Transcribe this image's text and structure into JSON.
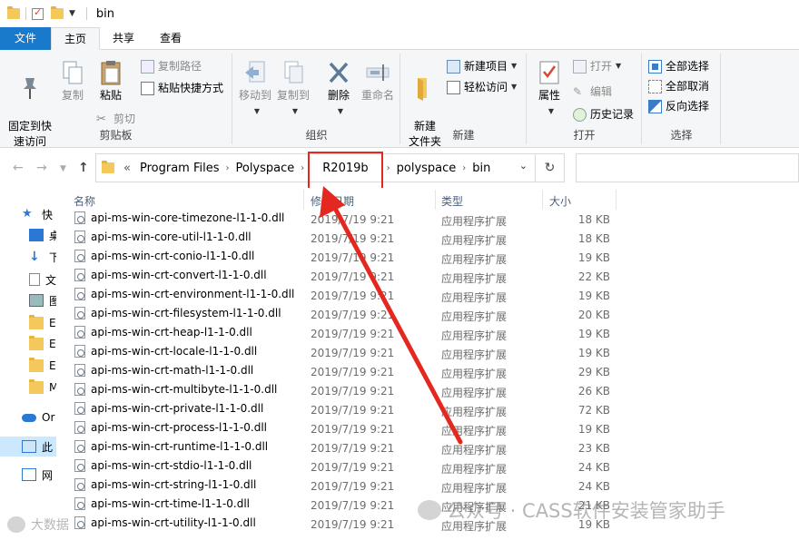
{
  "window": {
    "title": "bin"
  },
  "tabs": [
    "文件",
    "主页",
    "共享",
    "查看"
  ],
  "ribbon": {
    "clipboard": {
      "label": "剪贴板",
      "pin": "固定到快\n速访问",
      "copy": "复制",
      "paste": "粘贴",
      "copy_path": "复制路径",
      "paste_shortcut": "粘贴快捷方式",
      "cut": "剪切"
    },
    "organize": {
      "label": "组织",
      "move_to": "移动到",
      "copy_to": "复制到",
      "delete": "删除",
      "rename": "重命名"
    },
    "new": {
      "label": "新建",
      "new_folder": "新建\n文件夹",
      "new_item": "新建项目",
      "easy_access": "轻松访问"
    },
    "open": {
      "label": "打开",
      "properties": "属性",
      "open": "打开",
      "edit": "编辑",
      "history": "历史记录"
    },
    "select": {
      "label": "选择",
      "select_all": "全部选择",
      "select_none": "全部取消",
      "invert": "反向选择"
    }
  },
  "address": {
    "prefix": "«",
    "crumbs": [
      "Program Files",
      "Polyspace",
      "R2019b",
      "polyspace",
      "bin"
    ],
    "highlighted": "R2019b"
  },
  "nav": {
    "items": [
      "快",
      "桌",
      "下",
      "文",
      "图",
      "E",
      "E",
      "E",
      "M",
      "Or",
      "此",
      "网"
    ]
  },
  "columns": {
    "name": "名称",
    "date": "修改日期",
    "type": "类型",
    "size": "大小"
  },
  "files": [
    {
      "name": "api-ms-win-core-timezone-l1-1-0.dll",
      "date": "2019/7/19 9:21",
      "type": "应用程序扩展",
      "size": "18 KB"
    },
    {
      "name": "api-ms-win-core-util-l1-1-0.dll",
      "date": "2019/7/19 9:21",
      "type": "应用程序扩展",
      "size": "18 KB"
    },
    {
      "name": "api-ms-win-crt-conio-l1-1-0.dll",
      "date": "2019/7/19 9:21",
      "type": "应用程序扩展",
      "size": "19 KB"
    },
    {
      "name": "api-ms-win-crt-convert-l1-1-0.dll",
      "date": "2019/7/19 9:21",
      "type": "应用程序扩展",
      "size": "22 KB"
    },
    {
      "name": "api-ms-win-crt-environment-l1-1-0.dll",
      "date": "2019/7/19 9:21",
      "type": "应用程序扩展",
      "size": "19 KB"
    },
    {
      "name": "api-ms-win-crt-filesystem-l1-1-0.dll",
      "date": "2019/7/19 9:21",
      "type": "应用程序扩展",
      "size": "20 KB"
    },
    {
      "name": "api-ms-win-crt-heap-l1-1-0.dll",
      "date": "2019/7/19 9:21",
      "type": "应用程序扩展",
      "size": "19 KB"
    },
    {
      "name": "api-ms-win-crt-locale-l1-1-0.dll",
      "date": "2019/7/19 9:21",
      "type": "应用程序扩展",
      "size": "19 KB"
    },
    {
      "name": "api-ms-win-crt-math-l1-1-0.dll",
      "date": "2019/7/19 9:21",
      "type": "应用程序扩展",
      "size": "29 KB"
    },
    {
      "name": "api-ms-win-crt-multibyte-l1-1-0.dll",
      "date": "2019/7/19 9:21",
      "type": "应用程序扩展",
      "size": "26 KB"
    },
    {
      "name": "api-ms-win-crt-private-l1-1-0.dll",
      "date": "2019/7/19 9:21",
      "type": "应用程序扩展",
      "size": "72 KB"
    },
    {
      "name": "api-ms-win-crt-process-l1-1-0.dll",
      "date": "2019/7/19 9:21",
      "type": "应用程序扩展",
      "size": "19 KB"
    },
    {
      "name": "api-ms-win-crt-runtime-l1-1-0.dll",
      "date": "2019/7/19 9:21",
      "type": "应用程序扩展",
      "size": "23 KB"
    },
    {
      "name": "api-ms-win-crt-stdio-l1-1-0.dll",
      "date": "2019/7/19 9:21",
      "type": "应用程序扩展",
      "size": "24 KB"
    },
    {
      "name": "api-ms-win-crt-string-l1-1-0.dll",
      "date": "2019/7/19 9:21",
      "type": "应用程序扩展",
      "size": "24 KB"
    },
    {
      "name": "api-ms-win-crt-time-l1-1-0.dll",
      "date": "2019/7/19 9:21",
      "type": "应用程序扩展",
      "size": "21 KB"
    },
    {
      "name": "api-ms-win-crt-utility-l1-1-0.dll",
      "date": "2019/7/19 9:21",
      "type": "应用程序扩展",
      "size": "19 KB"
    }
  ],
  "watermarks": {
    "right": "公众号 · CASS软件安装管家助手",
    "left": "大数据"
  },
  "colors": {
    "file_tab": "#1979ca",
    "highlight": "#e5281f",
    "selection": "#cce8ff"
  },
  "icons": [
    "folder-icon",
    "checkbox-icon",
    "pin-icon",
    "copy-icon",
    "paste-icon",
    "scissors-icon",
    "delete-icon",
    "rename-icon",
    "properties-icon",
    "select-all-icon",
    "dll-file-icon",
    "refresh-icon",
    "up-arrow-icon"
  ]
}
